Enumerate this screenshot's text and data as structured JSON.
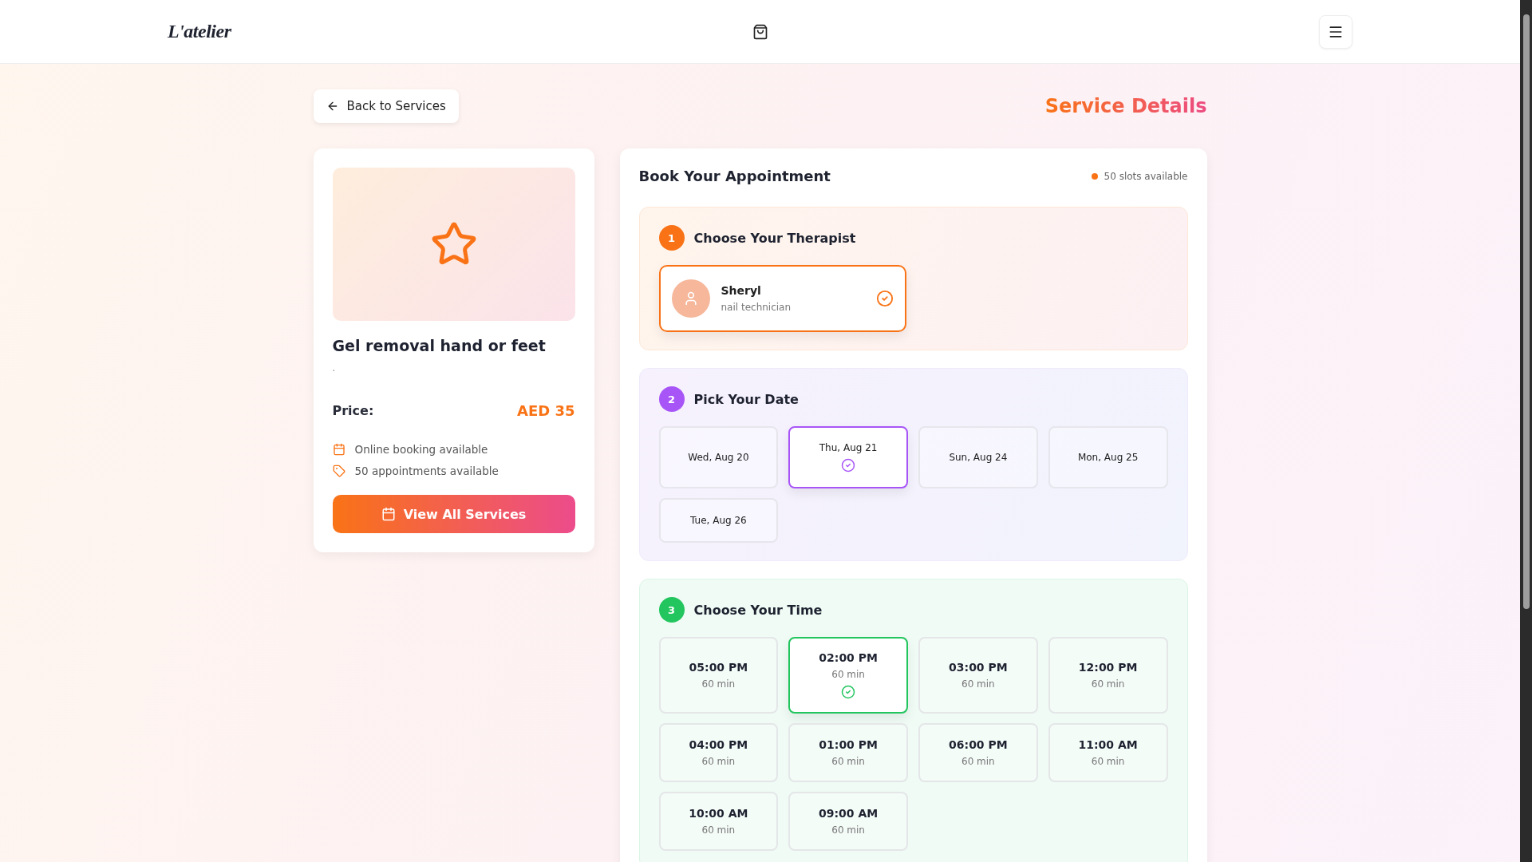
{
  "header": {
    "logo": "L'atelier"
  },
  "back_button": {
    "label": "Back to Services"
  },
  "page_title": "Service Details",
  "service": {
    "title": "Gel removal hand or feet",
    "description": ".",
    "price_label": "Price:",
    "price": "AED 35",
    "features": [
      {
        "kind": "calendar",
        "text": "Online booking available"
      },
      {
        "kind": "tag",
        "text": "50 appointments available"
      }
    ],
    "button": "View All Services"
  },
  "booking": {
    "title": "Book Your Appointment",
    "availability": "50 slots available",
    "steps": [
      {
        "kind": "therapist",
        "number": "1",
        "title": "Choose Your Therapist",
        "therapists": [
          {
            "name": "Sheryl",
            "role": "nail technician",
            "selected": true
          }
        ]
      },
      {
        "kind": "date",
        "number": "2",
        "title": "Pick Your Date",
        "dates": [
          {
            "label": "Wed, Aug 20",
            "selected": false
          },
          {
            "label": "Thu, Aug 21",
            "selected": true
          },
          {
            "label": "Sun, Aug 24",
            "selected": false
          },
          {
            "label": "Mon, Aug 25",
            "selected": false
          },
          {
            "label": "Tue, Aug 26",
            "selected": false
          }
        ]
      },
      {
        "kind": "time",
        "number": "3",
        "title": "Choose Your Time",
        "slots": [
          {
            "time": "05:00 PM",
            "duration": "60 min",
            "selected": false
          },
          {
            "time": "02:00 PM",
            "duration": "60 min",
            "selected": true
          },
          {
            "time": "03:00 PM",
            "duration": "60 min",
            "selected": false
          },
          {
            "time": "12:00 PM",
            "duration": "60 min",
            "selected": false
          },
          {
            "time": "04:00 PM",
            "duration": "60 min",
            "selected": false
          },
          {
            "time": "01:00 PM",
            "duration": "60 min",
            "selected": false
          },
          {
            "time": "06:00 PM",
            "duration": "60 min",
            "selected": false
          },
          {
            "time": "11:00 AM",
            "duration": "60 min",
            "selected": false
          },
          {
            "time": "10:00 AM",
            "duration": "60 min",
            "selected": false
          },
          {
            "time": "09:00 AM",
            "duration": "60 min",
            "selected": false
          }
        ]
      }
    ]
  }
}
